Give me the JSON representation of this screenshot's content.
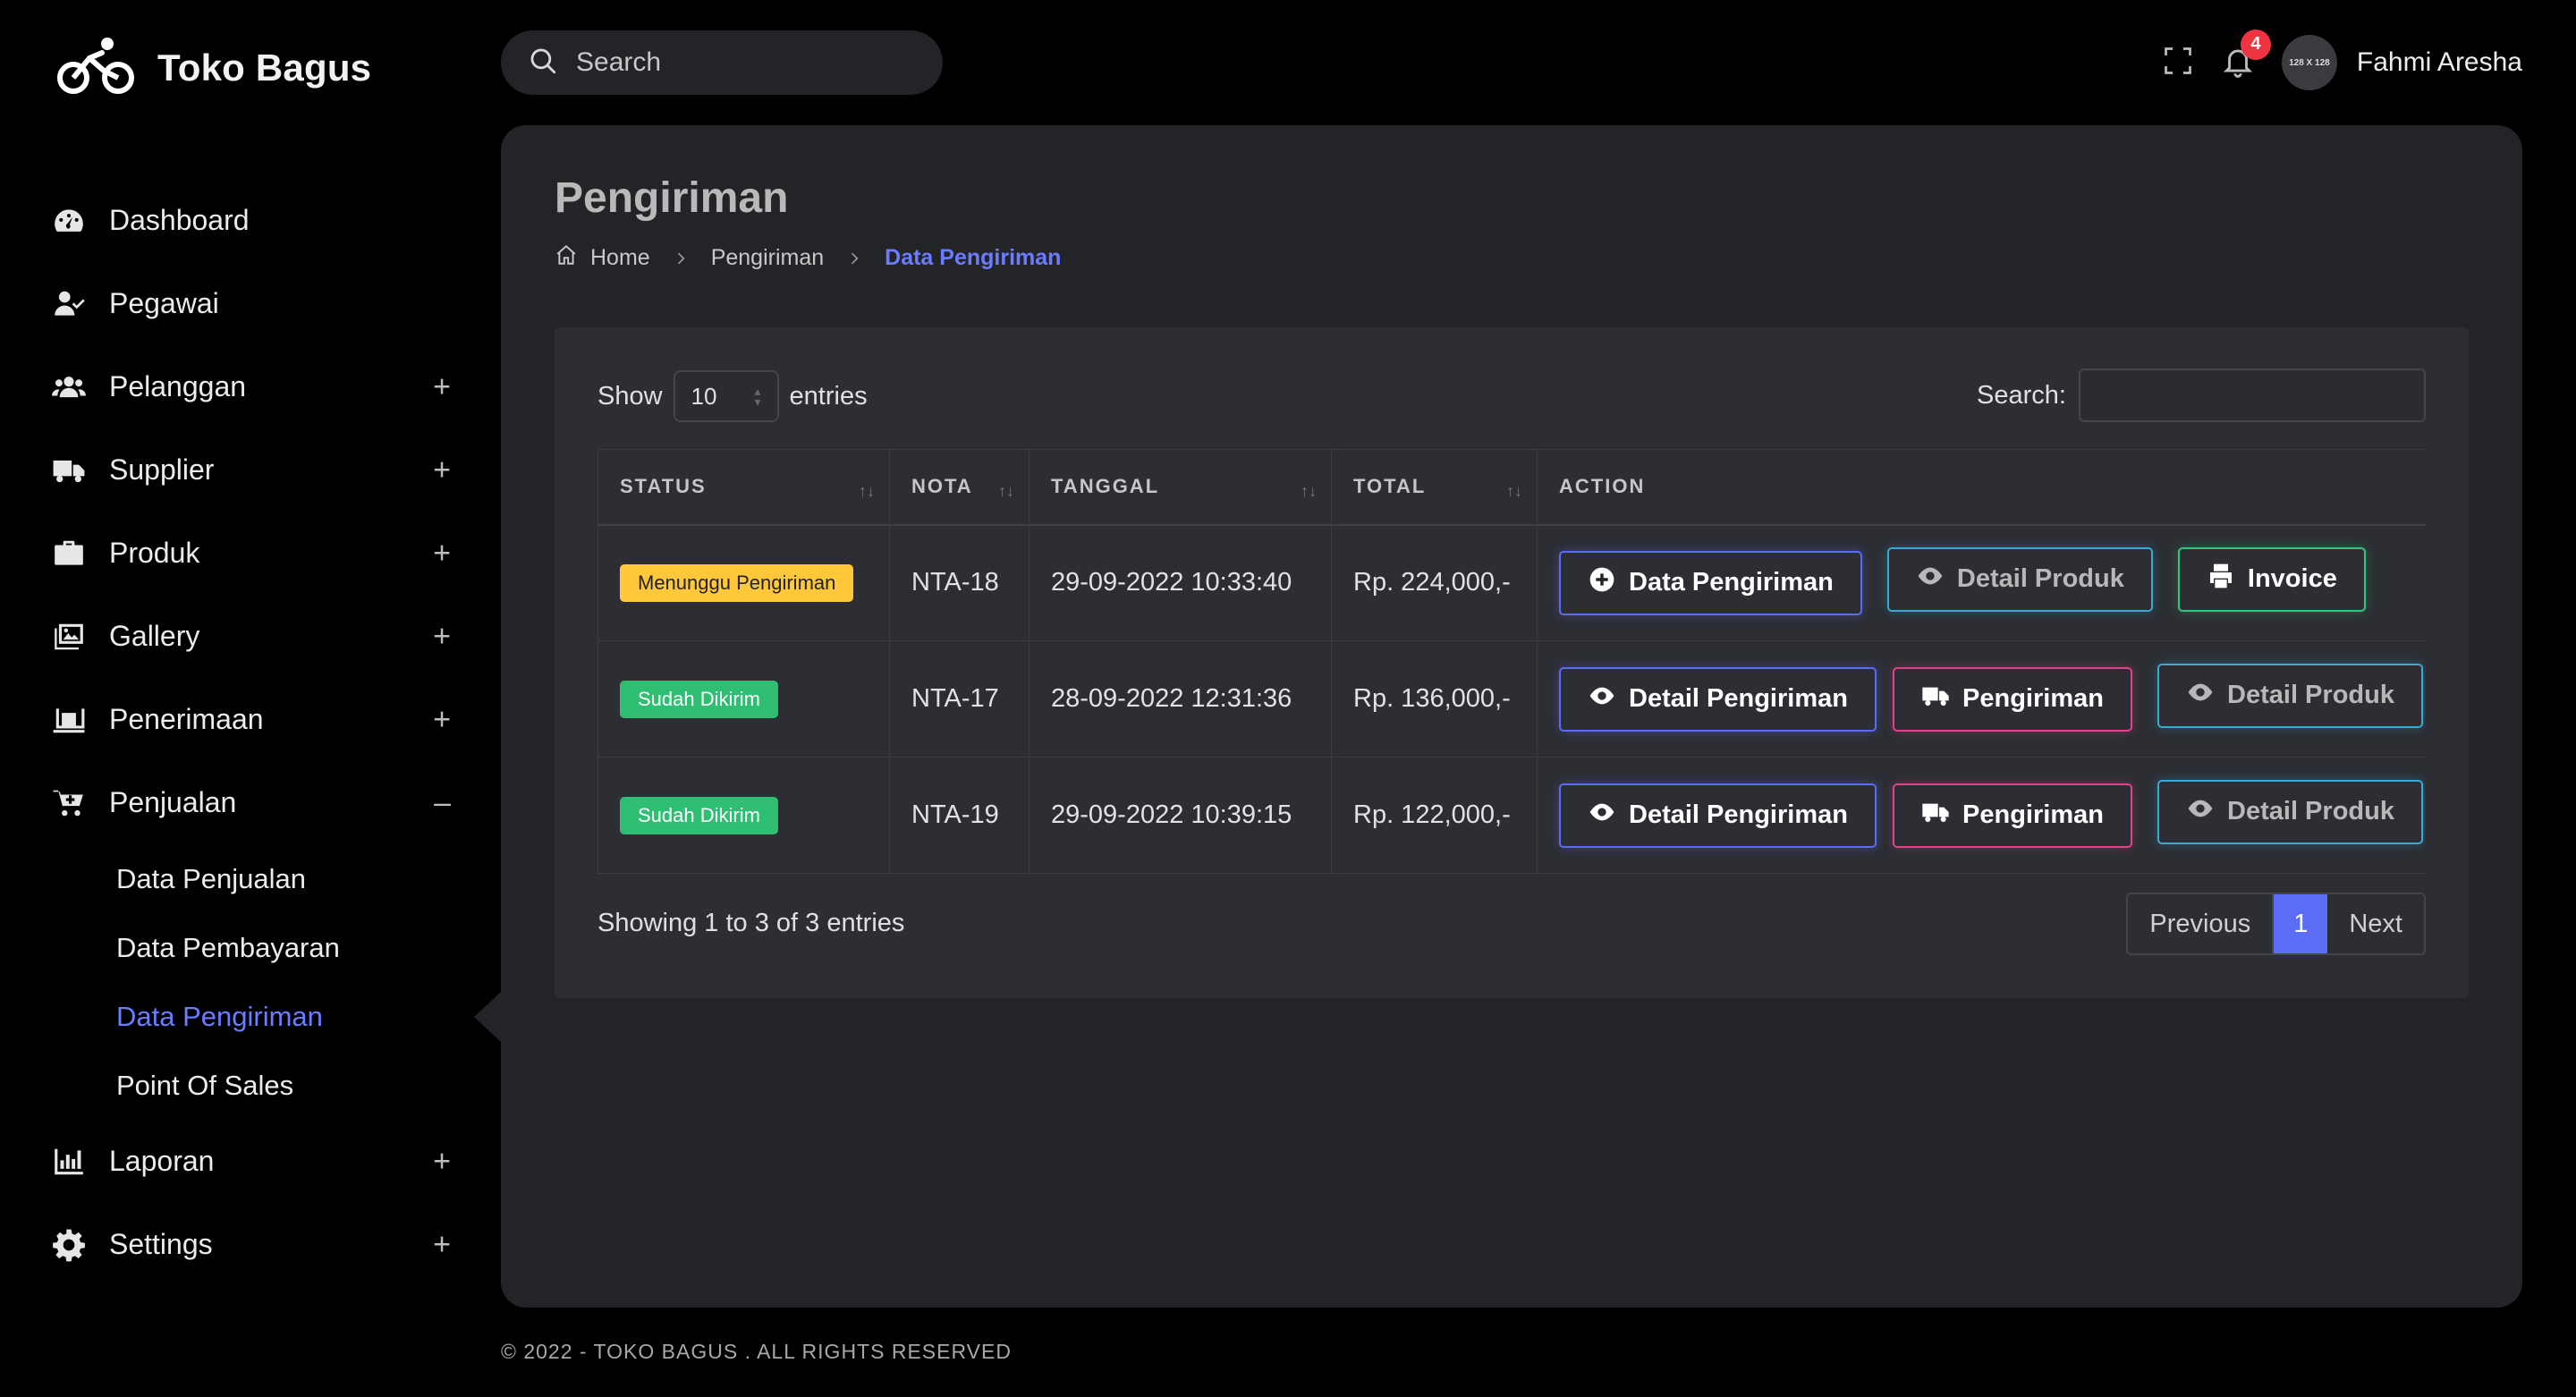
{
  "app": {
    "brand_name": "Toko Bagus"
  },
  "sidebar": {
    "items": [
      {
        "label": "Dashboard",
        "icon": "dashboard-icon",
        "toggle": ""
      },
      {
        "label": "Pegawai",
        "icon": "user-check-icon",
        "toggle": ""
      },
      {
        "label": "Pelanggan",
        "icon": "users-icon",
        "toggle": "+"
      },
      {
        "label": "Supplier",
        "icon": "truck-icon",
        "toggle": "+"
      },
      {
        "label": "Produk",
        "icon": "briefcase-icon",
        "toggle": "+"
      },
      {
        "label": "Gallery",
        "icon": "images-icon",
        "toggle": "+"
      },
      {
        "label": "Penerimaan",
        "icon": "receive-icon",
        "toggle": "+"
      },
      {
        "label": "Penjualan",
        "icon": "cart-icon",
        "toggle": "–"
      },
      {
        "label": "Laporan",
        "icon": "chart-icon",
        "toggle": "+"
      },
      {
        "label": "Settings",
        "icon": "gear-icon",
        "toggle": "+"
      }
    ],
    "penjualan_sub": [
      "Data Penjualan",
      "Data Pembayaran",
      "Data Pengiriman",
      "Point Of Sales"
    ]
  },
  "topbar": {
    "search_placeholder": "Search",
    "notification_count": "4",
    "avatar_text": "128 X 128",
    "username": "Fahmi Aresha"
  },
  "page": {
    "title": "Pengiriman",
    "breadcrumb": [
      "Home",
      "Pengiriman",
      "Data Pengiriman"
    ]
  },
  "table": {
    "show_label": "Show",
    "entries_value": "10",
    "entries_label": "entries",
    "search_label": "Search:",
    "columns": [
      "STATUS",
      "NOTA",
      "TANGGAL",
      "TOTAL",
      "ACTION"
    ],
    "rows": [
      {
        "status": "Menunggu Pengiriman",
        "nota": "NTA-18",
        "tanggal": "29-09-2022 10:33:40",
        "total": "Rp. 224,000,-",
        "actions": [
          "Data Pengiriman",
          "Detail Produk",
          "Invoice"
        ]
      },
      {
        "status": "Sudah Dikirim",
        "nota": "NTA-17",
        "tanggal": "28-09-2022 12:31:36",
        "total": "Rp. 136,000,-",
        "actions": [
          "Detail Pengiriman",
          "Pengiriman",
          "Detail Produk"
        ]
      },
      {
        "status": "Sudah Dikirim",
        "nota": "NTA-19",
        "tanggal": "29-09-2022 10:39:15",
        "total": "Rp. 122,000,-",
        "actions": [
          "Detail Pengiriman",
          "Pengiriman",
          "Detail Produk"
        ]
      }
    ],
    "showing_text": "Showing 1 to 3 of 3 entries",
    "pagination": {
      "previous": "Previous",
      "current": "1",
      "next": "Next"
    }
  },
  "footer": {
    "copyright": "© 2022 - TOKO BAGUS . ALL RIGHTS RESERVED"
  },
  "colors": {
    "accent": "#5b6cf5",
    "pending": "#ffc83a",
    "success": "#2ebf73",
    "pink": "#e0428e",
    "cyan": "#3aa9d6"
  }
}
